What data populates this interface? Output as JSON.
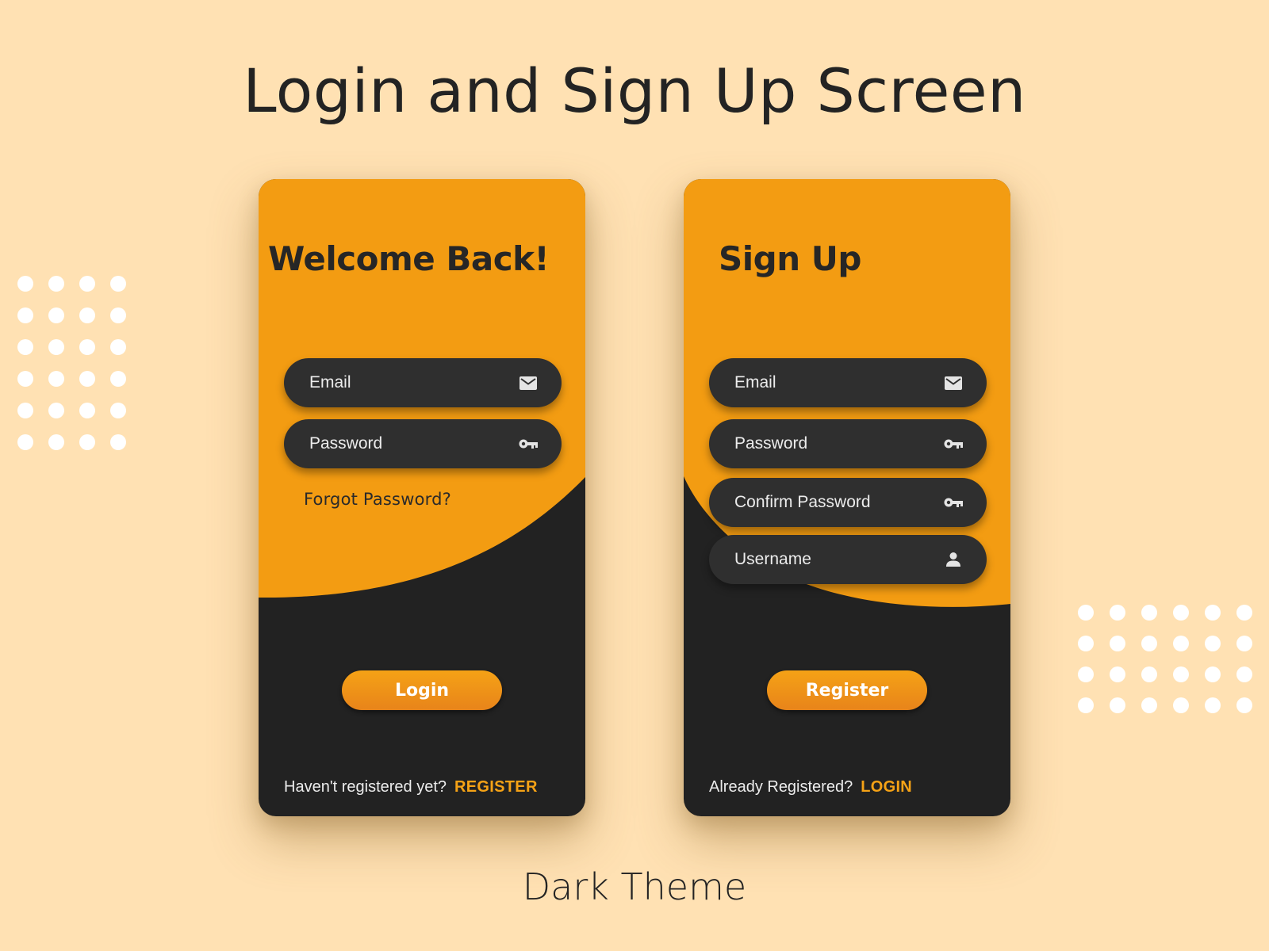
{
  "header": {
    "title": "Login and Sign Up Screen"
  },
  "footer": {
    "subtitle": "Dark Theme"
  },
  "theme": {
    "accent": "#f39c12",
    "dark": "#222222",
    "field": "#2f2f2f",
    "background": "#ffe1b3",
    "link": "#f5a216"
  },
  "login_screen": {
    "heading": "Welcome Back!",
    "fields": [
      {
        "label": "Email",
        "icon": "mail-icon"
      },
      {
        "label": "Password",
        "icon": "key-icon"
      }
    ],
    "forgot_password": "Forgot Password?",
    "submit_label": "Login",
    "footer_text": "Haven't registered yet?",
    "footer_link": "REGISTER"
  },
  "signup_screen": {
    "heading": "Sign Up",
    "fields": [
      {
        "label": "Email",
        "icon": "mail-icon"
      },
      {
        "label": "Password",
        "icon": "key-icon"
      },
      {
        "label": "Confirm Password",
        "icon": "key-icon"
      },
      {
        "label": "Username",
        "icon": "person-icon"
      }
    ],
    "submit_label": "Register",
    "footer_text": "Already Registered?",
    "footer_link": "LOGIN"
  }
}
